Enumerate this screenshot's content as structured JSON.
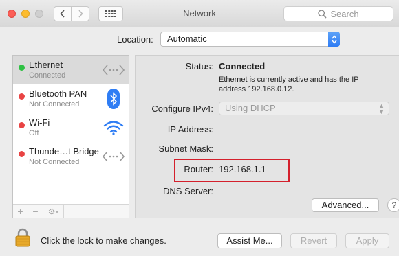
{
  "window": {
    "title": "Network",
    "search_placeholder": "Search"
  },
  "location": {
    "label": "Location:",
    "value": "Automatic"
  },
  "services": [
    {
      "name": "Ethernet",
      "status": "Connected",
      "dot_color": "#2fc144",
      "icon": "ethernet-icon",
      "selected": true
    },
    {
      "name": "Bluetooth PAN",
      "status": "Not Connected",
      "dot_color": "#e94444",
      "icon": "bluetooth-icon"
    },
    {
      "name": "Wi-Fi",
      "status": "Off",
      "dot_color": "#e94444",
      "icon": "wifi-icon"
    },
    {
      "name": "Thunde…t Bridge",
      "status": "Not Connected",
      "dot_color": "#e94444",
      "icon": "ethernet-icon"
    }
  ],
  "sidebar_tools": [
    "+",
    "−"
  ],
  "detail": {
    "status_label": "Status:",
    "status_value": "Connected",
    "status_desc": "Ethernet is currently active and has the IP address 192.168.0.12.",
    "ipv4_label": "Configure IPv4:",
    "ipv4_value": "Using DHCP",
    "ip_label": "IP Address:",
    "subnet_label": "Subnet Mask:",
    "router_label": "Router:",
    "router_value": "192.168.1.1",
    "dns_label": "DNS Server:",
    "advanced_label": "Advanced...",
    "help_label": "?"
  },
  "bottom": {
    "lock_text": "Click the lock to make changes.",
    "assist_label": "Assist Me...",
    "revert_label": "Revert",
    "apply_label": "Apply"
  },
  "colors": {
    "highlight_box": "#d4202c",
    "select_accent": "#2e7cf4",
    "connected": "#2fc144",
    "disconnected": "#e94444"
  }
}
